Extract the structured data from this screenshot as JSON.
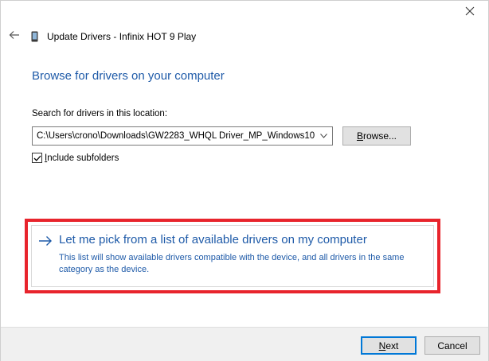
{
  "window": {
    "title": "Update Drivers - Infinix HOT 9 Play"
  },
  "page": {
    "heading": "Browse for drivers on your computer",
    "search_label": "Search for drivers in this location:",
    "path_value": "C:\\Users\\crono\\Downloads\\GW2283_WHQL Driver_MP_Windows10",
    "browse_label_prefix": "",
    "browse_label_mnemonic": "B",
    "browse_label_rest": "rowse...",
    "include_subfolders_mnemonic": "I",
    "include_subfolders_rest": "nclude subfolders",
    "include_subfolders_checked": true
  },
  "pick_option": {
    "title": "Let me pick from a list of available drivers on my computer",
    "description": "This list will show available drivers compatible with the device, and all drivers in the same category as the device."
  },
  "footer": {
    "next_mnemonic": "N",
    "next_rest": "ext",
    "cancel_label": "Cancel"
  },
  "colors": {
    "accent_blue": "#1e5aa8",
    "highlight_red": "#e8242c"
  },
  "icons": {
    "close": "close-icon",
    "back": "back-arrow-icon",
    "device": "phone-icon",
    "dropdown": "chevron-down-icon",
    "pick_arrow": "arrow-right-icon",
    "checkbox": "checkmark-icon"
  }
}
